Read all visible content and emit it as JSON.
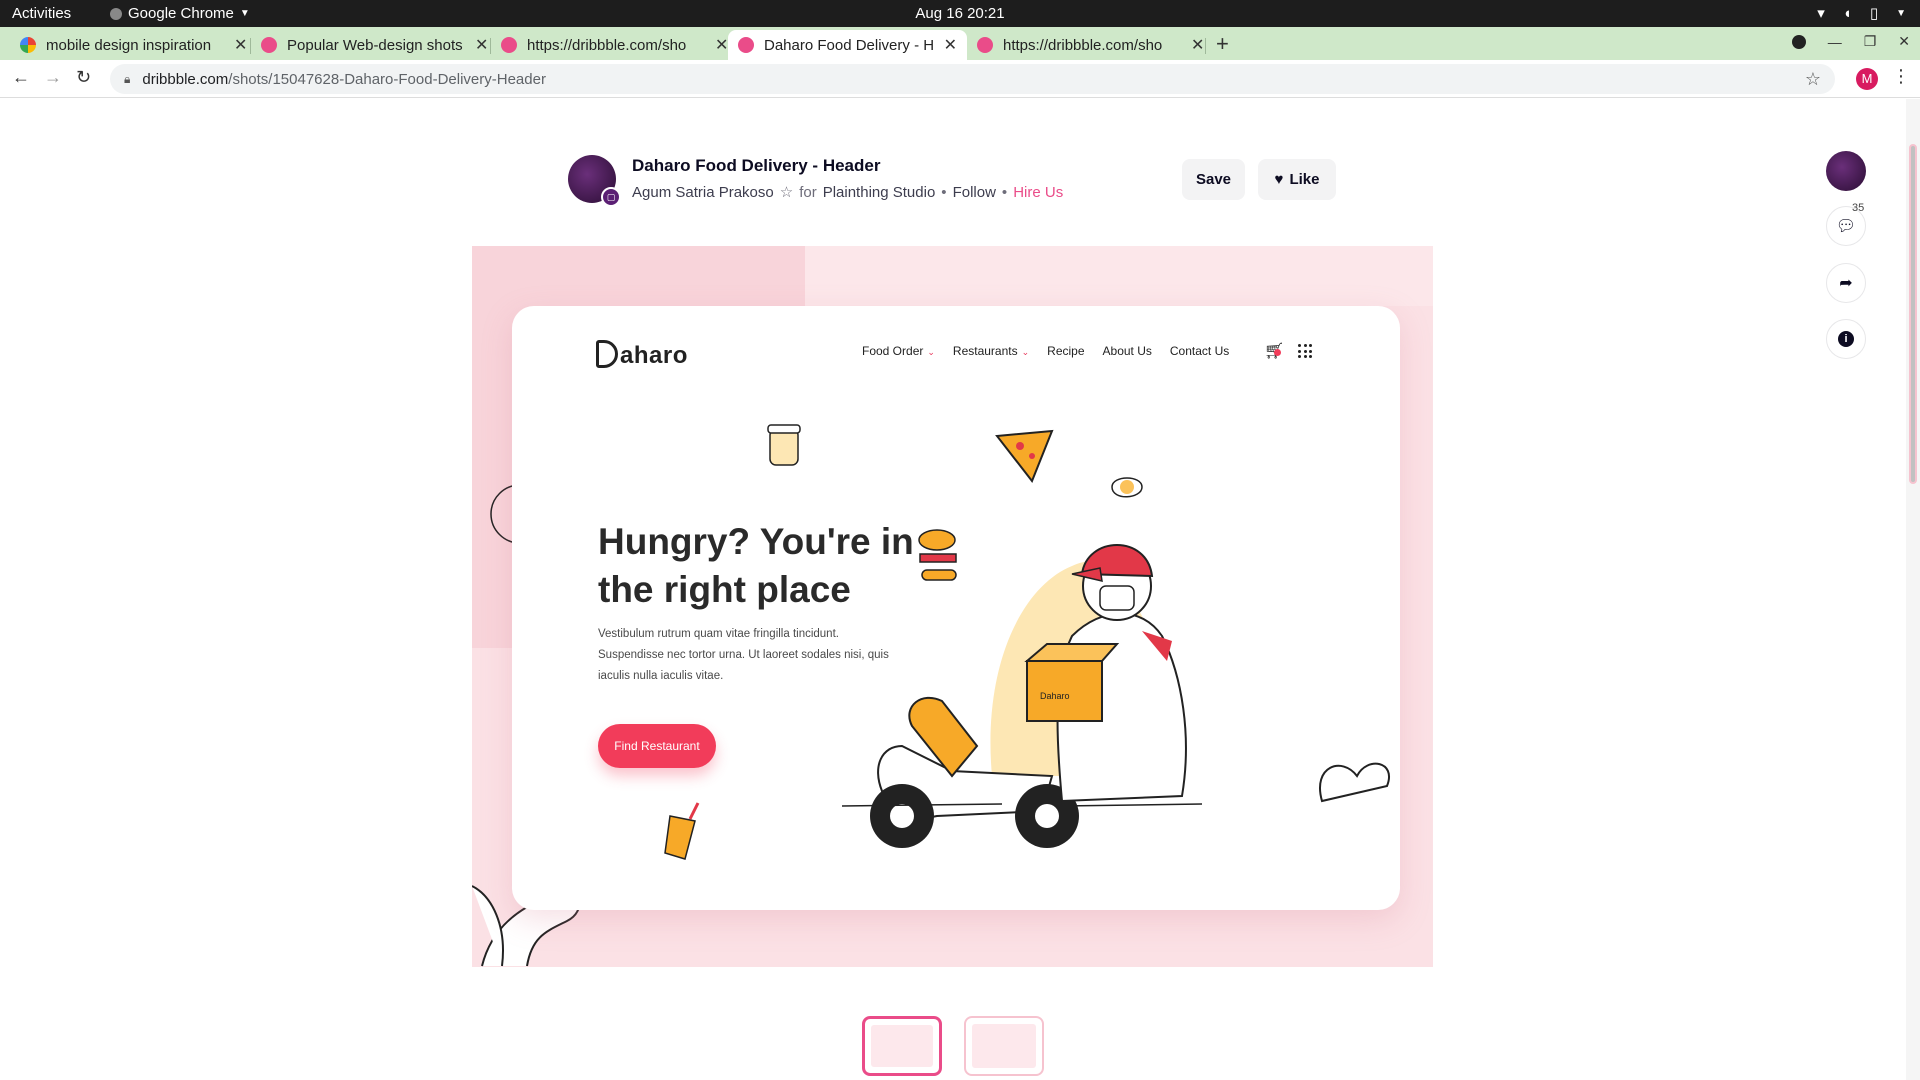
{
  "system_bar": {
    "activities": "Activities",
    "app_name": "Google Chrome",
    "datetime": "Aug 16  20:21"
  },
  "browser": {
    "tabs": [
      {
        "title": "mobile design inspiration",
        "favicon": "google-icon",
        "active": false
      },
      {
        "title": "Popular Web-design shots",
        "favicon": "dribbble-icon",
        "active": false
      },
      {
        "title": "https://dribbble.com/sho",
        "favicon": "dribbble-icon",
        "active": false
      },
      {
        "title": "Daharo Food Delivery - He",
        "favicon": "dribbble-icon",
        "active": true
      },
      {
        "title": "https://dribbble.com/sho",
        "favicon": "dribbble-icon",
        "active": false
      }
    ],
    "url_domain": "dribbble.com",
    "url_path": "/shots/15047628-Daharo-Food-Delivery-Header",
    "profile_initial": "M"
  },
  "shot": {
    "title": "Daharo Food Delivery - Header",
    "author": "Agum Satria Prakoso",
    "for_label": "for",
    "team": "Plainthing Studio",
    "follow_label": "Follow",
    "hire_label": "Hire Us",
    "save_label": "Save",
    "like_label": "Like",
    "comment_count": "35"
  },
  "design": {
    "brand": "aharo",
    "nav": [
      "Food Order",
      "Restaurants",
      "Recipe",
      "About Us",
      "Contact Us"
    ],
    "headline": "Hungry? You're in the right place",
    "body": "Vestibulum rutrum quam vitae fringilla tincidunt. Suspendisse nec tortor urna. Ut laoreet sodales nisi, quis iaculis nulla iaculis vitae.",
    "cta": "Find Restaurant",
    "box_label": "Daharo"
  },
  "colors": {
    "accent": "#f23c5a",
    "dribbble_pink": "#ea4c89",
    "shot_background": "#fbe1e5",
    "tab_strip": "#cfe8c9"
  }
}
